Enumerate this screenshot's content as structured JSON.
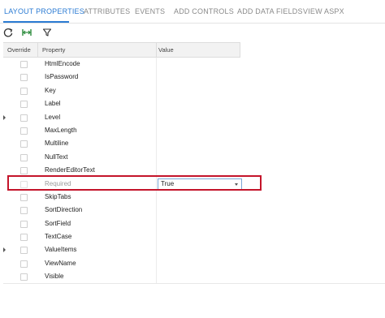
{
  "tabs": [
    {
      "label": "LAYOUT PROPERTIES",
      "active": true
    },
    {
      "label": "ATTRIBUTES",
      "active": false
    },
    {
      "label": "EVENTS",
      "active": false
    },
    {
      "label": "ADD CONTROLS",
      "active": false
    },
    {
      "label": "ADD DATA FIELDS",
      "active": false
    },
    {
      "label": "VIEW ASPX",
      "active": false
    }
  ],
  "toolbar": {
    "icons": [
      "refresh-icon",
      "fit-columns-icon",
      "filter-icon"
    ]
  },
  "grid": {
    "columns": [
      "Override",
      "Property",
      "Value"
    ],
    "rows": [
      {
        "property": "HtmlEncode",
        "marker": false
      },
      {
        "property": "IsPassword",
        "marker": false
      },
      {
        "property": "Key",
        "marker": false
      },
      {
        "property": "Label",
        "marker": false
      },
      {
        "property": "Level",
        "marker": true
      },
      {
        "property": "MaxLength",
        "marker": false
      },
      {
        "property": "Multiline",
        "marker": false
      },
      {
        "property": "NullText",
        "marker": false
      },
      {
        "property": "RenderEditorText",
        "marker": false
      },
      {
        "property": "Required",
        "marker": false,
        "value": "True",
        "selected": true
      },
      {
        "property": "SkipTabs",
        "marker": false
      },
      {
        "property": "SortDirection",
        "marker": false
      },
      {
        "property": "SortField",
        "marker": false
      },
      {
        "property": "TextCase",
        "marker": false
      },
      {
        "property": "ValueItems",
        "marker": true
      },
      {
        "property": "ViewName",
        "marker": false
      },
      {
        "property": "Visible",
        "marker": false
      }
    ]
  },
  "colors": {
    "accent": "#2b7bd3",
    "highlight": "#c4142a"
  }
}
